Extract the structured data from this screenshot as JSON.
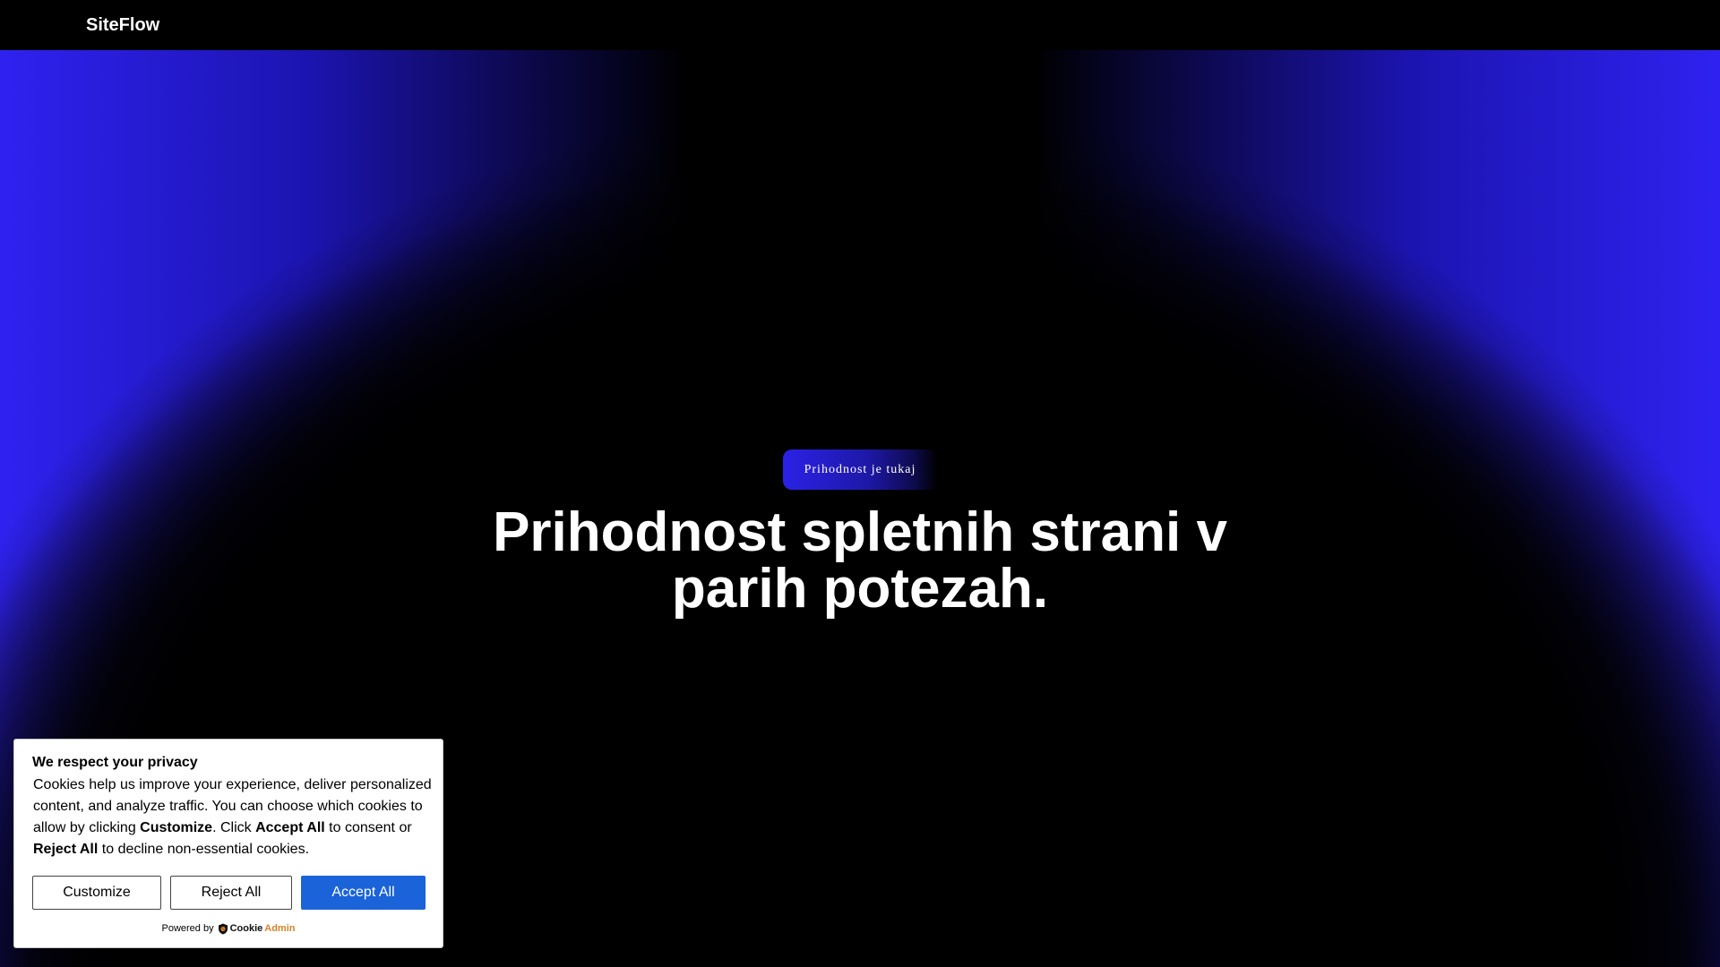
{
  "header": {
    "brand": "SiteFlow"
  },
  "hero": {
    "badge": "Prihodnost je tukaj",
    "headline_line1": "Prihodnost spletnih strani v",
    "headline_line2": "parih potezah."
  },
  "cookie_banner": {
    "title": "We respect your privacy",
    "text_part1": "Cookies help us improve your experience, deliver personalized content, and analyze traffic. You can choose which cookies to allow by clicking ",
    "text_bold_customize": "Customize",
    "text_part2": ". Click ",
    "text_bold_accept": "Accept All",
    "text_part3": " to consent or ",
    "text_bold_reject": "Reject All",
    "text_part4": " to decline non-essential cookies.",
    "customize_label": "Customize",
    "reject_label": "Reject All",
    "accept_label": "Accept All",
    "powered_by": "Powered by",
    "logo_part1": "Cookie",
    "logo_part2": "Admin"
  },
  "colors": {
    "accent_blue": "#2f22f0",
    "accept_button": "#1a63d8",
    "background": "#000000",
    "logo_orange": "#d9822b"
  },
  "icons": {
    "cookieadmin_logo": "shield-cookie-icon"
  }
}
